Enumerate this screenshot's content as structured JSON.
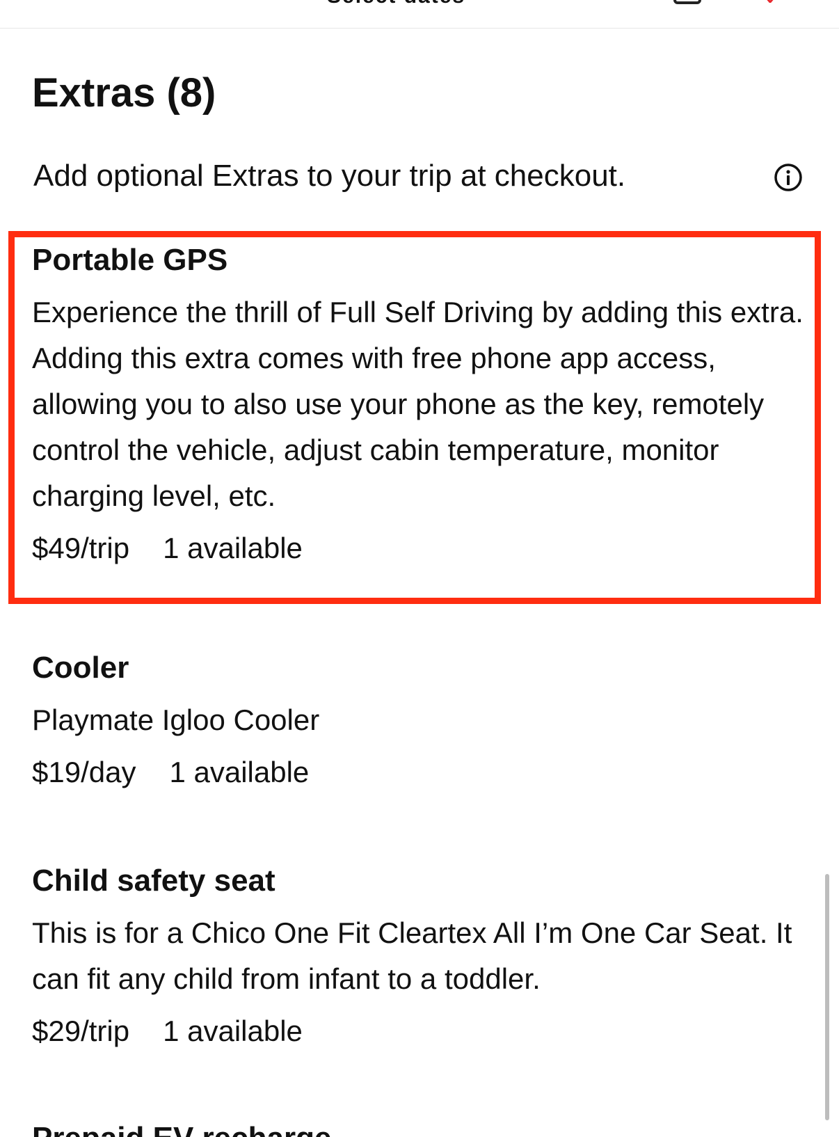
{
  "header": {
    "title": "Select dates"
  },
  "extras_section": {
    "title": "Extras (8)",
    "subtitle": "Add optional Extras to your trip at checkout."
  },
  "extras": [
    {
      "name": "Portable GPS",
      "description": "Experience the thrill of Full Self Driving by adding this extra. Adding this extra comes with free phone app access, allowing you to also use your phone as the key, remotely control the vehicle, adjust cabin temperature, monitor charging level, etc.",
      "price": "$49/trip",
      "availability": "1 available",
      "highlighted": true
    },
    {
      "name": "Cooler",
      "description": "Playmate Igloo Cooler",
      "price": "$19/day",
      "availability": "1 available"
    },
    {
      "name": "Child safety seat",
      "description": "This is for a Chico One Fit Cleartex All I’m One Car Seat. It can fit any child from infant to a toddler.",
      "price": "$29/trip",
      "availability": "1 available"
    },
    {
      "name": "Prepaid EV recharge"
    }
  ],
  "colors": {
    "highlight": "#ff2d10",
    "text": "#111111",
    "accent": "#e8262b"
  },
  "icons": {
    "info": "info-circle-icon",
    "calendar": "calendar-icon",
    "heart": "heart-icon"
  }
}
